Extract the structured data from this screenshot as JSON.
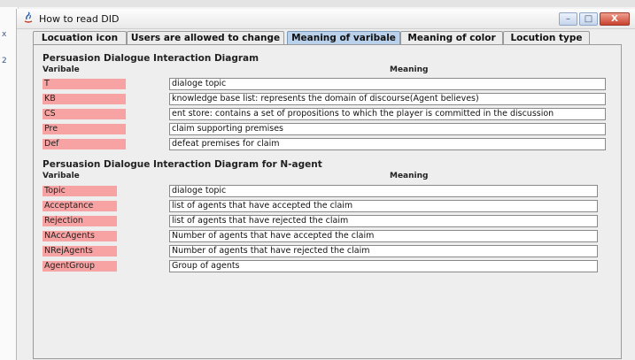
{
  "window": {
    "title": "How to read DID",
    "min_label": "–",
    "max_label": "□",
    "close_label": "X"
  },
  "tabs": [
    {
      "label": "Locuation icon"
    },
    {
      "label": "Users are allowed to change"
    },
    {
      "label": "Meaning of varibale",
      "active": true
    },
    {
      "label": "Meaning of color"
    },
    {
      "label": "Locution type"
    }
  ],
  "section1": {
    "title": "Persuasion Dialogue Interaction Diagram",
    "col_variable": "Varibale",
    "col_meaning": "Meaning",
    "rows": [
      {
        "variable": "T",
        "meaning": "dialoge topic"
      },
      {
        "variable": "KB",
        "meaning": "knowledge base list: represents the domain of discourse(Agent believes)"
      },
      {
        "variable": "CS",
        "meaning": "ent store: contains a set of propositions to which the player is committed in the discussion"
      },
      {
        "variable": "Pre",
        "meaning": "claim supporting premises"
      },
      {
        "variable": "Def",
        "meaning": "defeat premises for claim"
      }
    ]
  },
  "section2": {
    "title": "Persuasion Dialogue Interaction Diagram for N-agent",
    "col_variable": "Varibale",
    "col_meaning": "Meaning",
    "rows": [
      {
        "variable": "Topic",
        "meaning": "dialoge topic"
      },
      {
        "variable": "Acceptance",
        "meaning": "list of agents that have accepted the claim"
      },
      {
        "variable": "Rejection",
        "meaning": "list of agents that have rejected the claim"
      },
      {
        "variable": "NAccAgents",
        "meaning": "Number of agents that have accepted the claim"
      },
      {
        "variable": "NRejAgents",
        "meaning": "Number of agents that have rejected the claim"
      },
      {
        "variable": "AgentGroup",
        "meaning": "Group of agents"
      }
    ]
  },
  "colors": {
    "label_bg": "#f7a3a3",
    "active_tab": "#b9d1ea"
  }
}
